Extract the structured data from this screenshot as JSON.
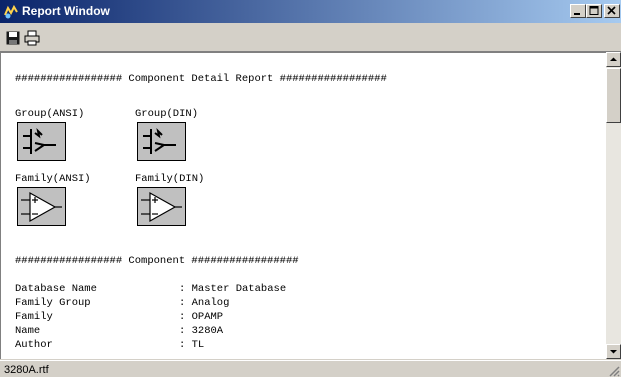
{
  "window": {
    "title": "Report Window"
  },
  "toolbar": {
    "save_icon": "save-disk-icon",
    "print_icon": "printer-icon"
  },
  "report": {
    "header1": "################# Component Detail Report #################",
    "symbols": [
      {
        "label": "Group(ANSI)",
        "icon": "group-ansi-symbol"
      },
      {
        "label": "Group(DIN)",
        "icon": "group-din-symbol"
      },
      {
        "label": "Family(ANSI)",
        "icon": "family-ansi-symbol"
      },
      {
        "label": "Family(DIN)",
        "icon": "family-din-symbol"
      }
    ],
    "header2": "################# Component #################",
    "fields": [
      {
        "name": "Database Name",
        "value": ": Master Database"
      },
      {
        "name": "Family Group",
        "value": ": Analog"
      },
      {
        "name": "Family",
        "value": ": OPAMP"
      },
      {
        "name": "Name",
        "value": ": 3280A"
      },
      {
        "name": "Author",
        "value": ": TL"
      }
    ]
  },
  "status": {
    "text": "3280A.rtf"
  }
}
